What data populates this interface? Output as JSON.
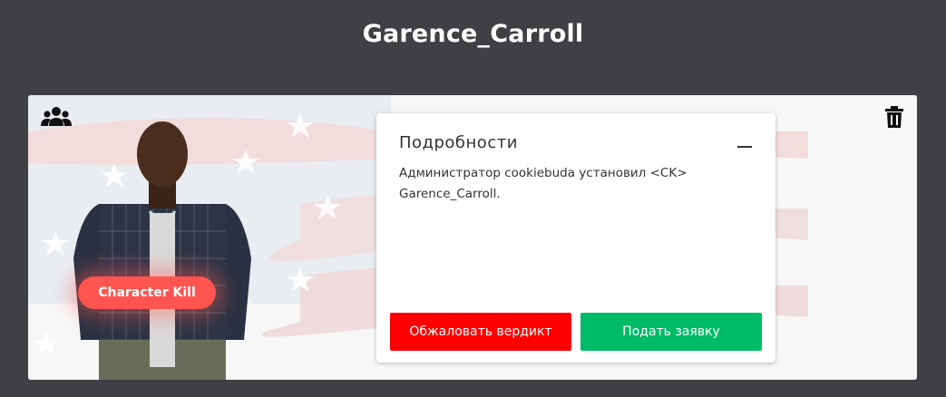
{
  "page": {
    "title": "Garence_Carroll"
  },
  "card": {
    "badge_label": "Character Kill",
    "icons": {
      "left": "group-users-icon",
      "right": "trash-icon"
    }
  },
  "details": {
    "title": "Подробности",
    "text": "Администратор cookiebuda установил <CK> Garence_Carroll.",
    "appeal_button": "Обжаловать вердикт",
    "submit_button": "Подать заявку"
  },
  "colors": {
    "background": "#3f4043",
    "badge": "#ff544f",
    "appeal": "#ff0000",
    "submit": "#00bb66"
  }
}
